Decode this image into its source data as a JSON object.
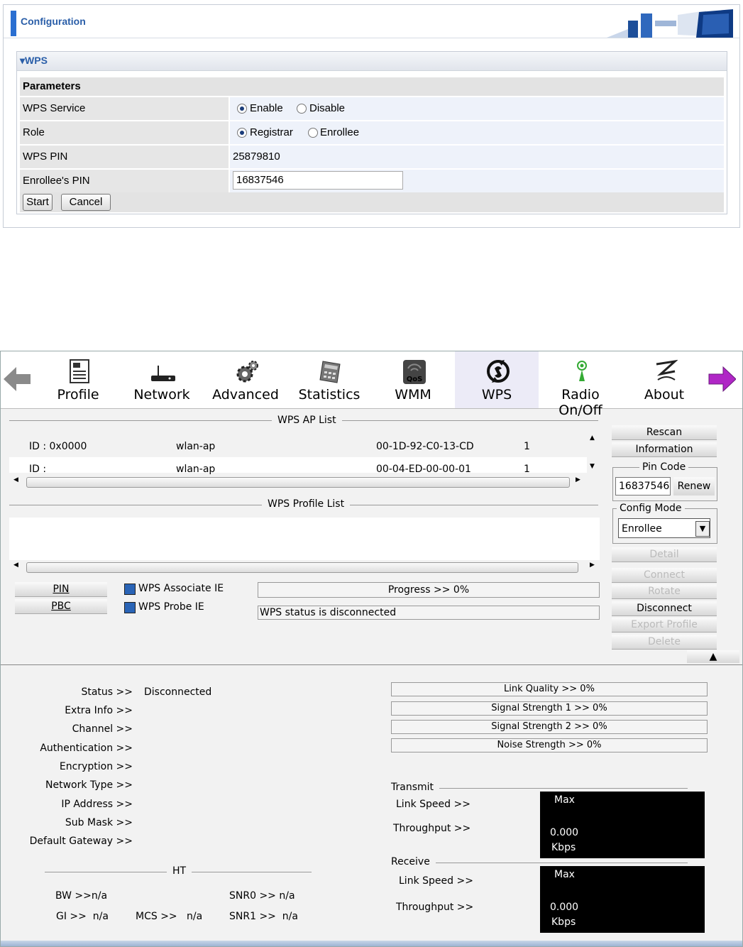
{
  "config": {
    "title": "Configuration",
    "section": "WPS",
    "params_header": "Parameters",
    "rows": {
      "service": {
        "label": "WPS Service",
        "opt1": "Enable",
        "opt2": "Disable"
      },
      "role": {
        "label": "Role",
        "opt1": "Registrar",
        "opt2": "Enrollee"
      },
      "pin": {
        "label": "WPS PIN",
        "value": "25879810"
      },
      "enrollee": {
        "label": "Enrollee's PIN",
        "value": "16837546"
      }
    },
    "start": "Start",
    "cancel": "Cancel"
  },
  "toolbar": {
    "items": [
      "Profile",
      "Network",
      "Advanced",
      "Statistics",
      "WMM",
      "WPS",
      "Radio On/Off",
      "About"
    ],
    "active": "WPS"
  },
  "ap_list": {
    "title": "WPS AP List",
    "rows": [
      {
        "id": "ID : 0x0000",
        "ssid": "wlan-ap",
        "mac": "00-1D-92-C0-13-CD",
        "ch": "1"
      },
      {
        "id": "ID :",
        "ssid": "wlan-ap",
        "mac": "00-04-ED-00-00-01",
        "ch": "1"
      }
    ]
  },
  "profile_list": {
    "title": "WPS Profile List"
  },
  "side": {
    "rescan": "Rescan",
    "information": "Information",
    "pin_code_label": "Pin Code",
    "pin_code": "16837546",
    "renew": "Renew",
    "config_mode_label": "Config Mode",
    "config_mode": "Enrollee",
    "detail": "Detail",
    "connect": "Connect",
    "rotate": "Rotate",
    "disconnect": "Disconnect",
    "export": "Export Profile",
    "delete": "Delete"
  },
  "actions": {
    "pin": "PIN",
    "pbc": "PBC",
    "assoc_ie": "WPS Associate IE",
    "probe_ie": "WPS Probe IE",
    "progress": "Progress >> 0%",
    "progress_value": 0,
    "status": "WPS status is disconnected"
  },
  "info": {
    "status_label": "Status >>",
    "status_value": "Disconnected",
    "labels": [
      "Extra Info >>",
      "Channel >>",
      "Authentication >>",
      "Encryption >>",
      "Network Type >>",
      "IP Address >>",
      "Sub Mask >>",
      "Default Gateway >>"
    ]
  },
  "meters": [
    "Link Quality >> 0%",
    "Signal Strength 1 >> 0%",
    "Signal Strength 2 >> 0%",
    "Noise Strength >> 0%"
  ],
  "ht": {
    "title": "HT",
    "bw": "BW >>n/a",
    "gi": "GI >>  n/a",
    "mcs": "MCS >>   n/a",
    "snr0": "SNR0 >>  n/a",
    "snr1": "SNR1 >>  n/a"
  },
  "transmit": {
    "title": "Transmit",
    "link": "Link Speed >>",
    "through": "Throughput >>",
    "max": "Max",
    "value": "0.000",
    "unit": "Kbps"
  },
  "receive": {
    "title": "Receive",
    "link": "Link Speed >>",
    "through": "Throughput >>",
    "max": "Max",
    "value": "0.000",
    "unit": "Kbps"
  }
}
